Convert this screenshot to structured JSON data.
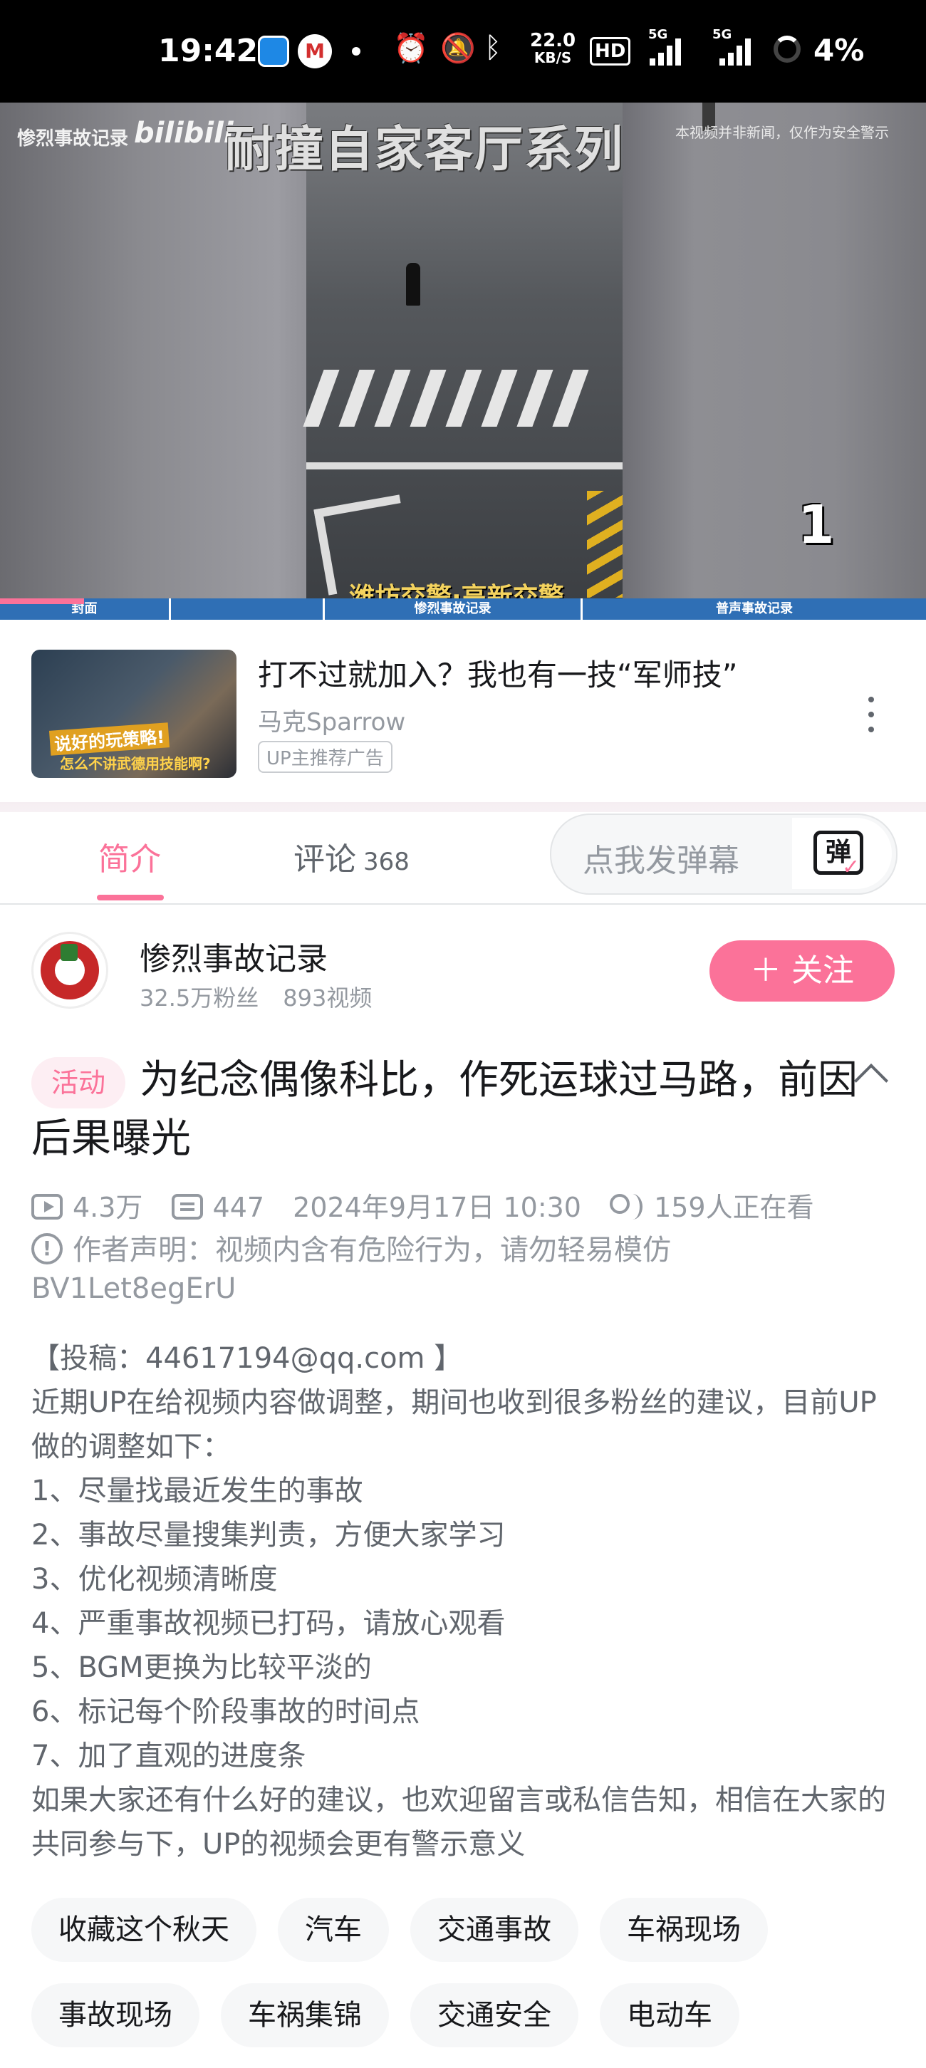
{
  "status_bar": {
    "time": "19:42",
    "app2_glyph": "M",
    "speed_value": "22.0",
    "speed_unit": "KB/S",
    "hd_label": "HD",
    "net1": "5G",
    "net2": "5G",
    "battery": "4%",
    "icons": [
      "alarm-icon",
      "mute-icon",
      "bluetooth-icon"
    ]
  },
  "video": {
    "watermark": "惨烈事故记录",
    "bili_logo": "bilibili",
    "overlay_title": "耐撞自家客厅系列",
    "notice": "本视频并非新闻，仅作为安全警示",
    "counter": "1",
    "bottom_caption": "潍坊交警·高新交警",
    "chapters": [
      "封面",
      "惨烈事故记录",
      "普声事故记录"
    ]
  },
  "ad": {
    "thumb_text1": "说好的玩策略!",
    "thumb_text2": "怎么不讲武德用技能啊?",
    "title": "打不过就加入？我也有一技“军师技”",
    "author": "马克Sparrow",
    "badge": "UP主推荐广告"
  },
  "tabs": {
    "intro": "简介",
    "comments": "评论",
    "comments_count": "368",
    "danmaku_placeholder": "点我发弹幕",
    "danmaku_icon_glyph": "弹"
  },
  "uploader": {
    "name": "惨烈事故记录",
    "fans": "32.5万粉丝",
    "videos": "893视频",
    "follow_label": "＋ 关注"
  },
  "video_info": {
    "tag": "活动",
    "title": "为纪念偶像科比，作死运球过马路，前因后果曝光",
    "views": "4.3万",
    "danmaku": "447",
    "date": "2024年9月17日 10:30",
    "watching": "159人正在看",
    "declaration": "作者声明：视频内含有危险行为，请勿轻易模仿",
    "bvid": "BV1Let8egErU"
  },
  "description": [
    "【投稿：44617194@qq.com 】",
    "近期UP在给视频内容做调整，期间也收到很多粉丝的建议，目前UP做的调整如下：",
    "1、尽量找最近发生的事故",
    "2、事故尽量搜集判责，方便大家学习",
    "3、优化视频清晰度",
    "4、严重事故视频已打码，请放心观看",
    "5、BGM更换为比较平淡的",
    "6、标记每个阶段事故的时间点",
    "7、加了直观的进度条",
    "如果大家还有什么好的建议，也欢迎留言或私信告知，相信在大家的共同参与下，UP的视频会更有警示意义"
  ],
  "tags_row1": [
    "收藏这个秋天",
    "汽车",
    "交通事故",
    "车祸现场"
  ],
  "tags_row2": [
    "事故现场",
    "车祸集锦",
    "交通安全",
    "电动车"
  ],
  "colors": {
    "accent": "#fb7299",
    "text_primary": "#18191c",
    "text_secondary": "#61666d",
    "text_muted": "#9499a0",
    "progress": "#2f6fb5"
  }
}
